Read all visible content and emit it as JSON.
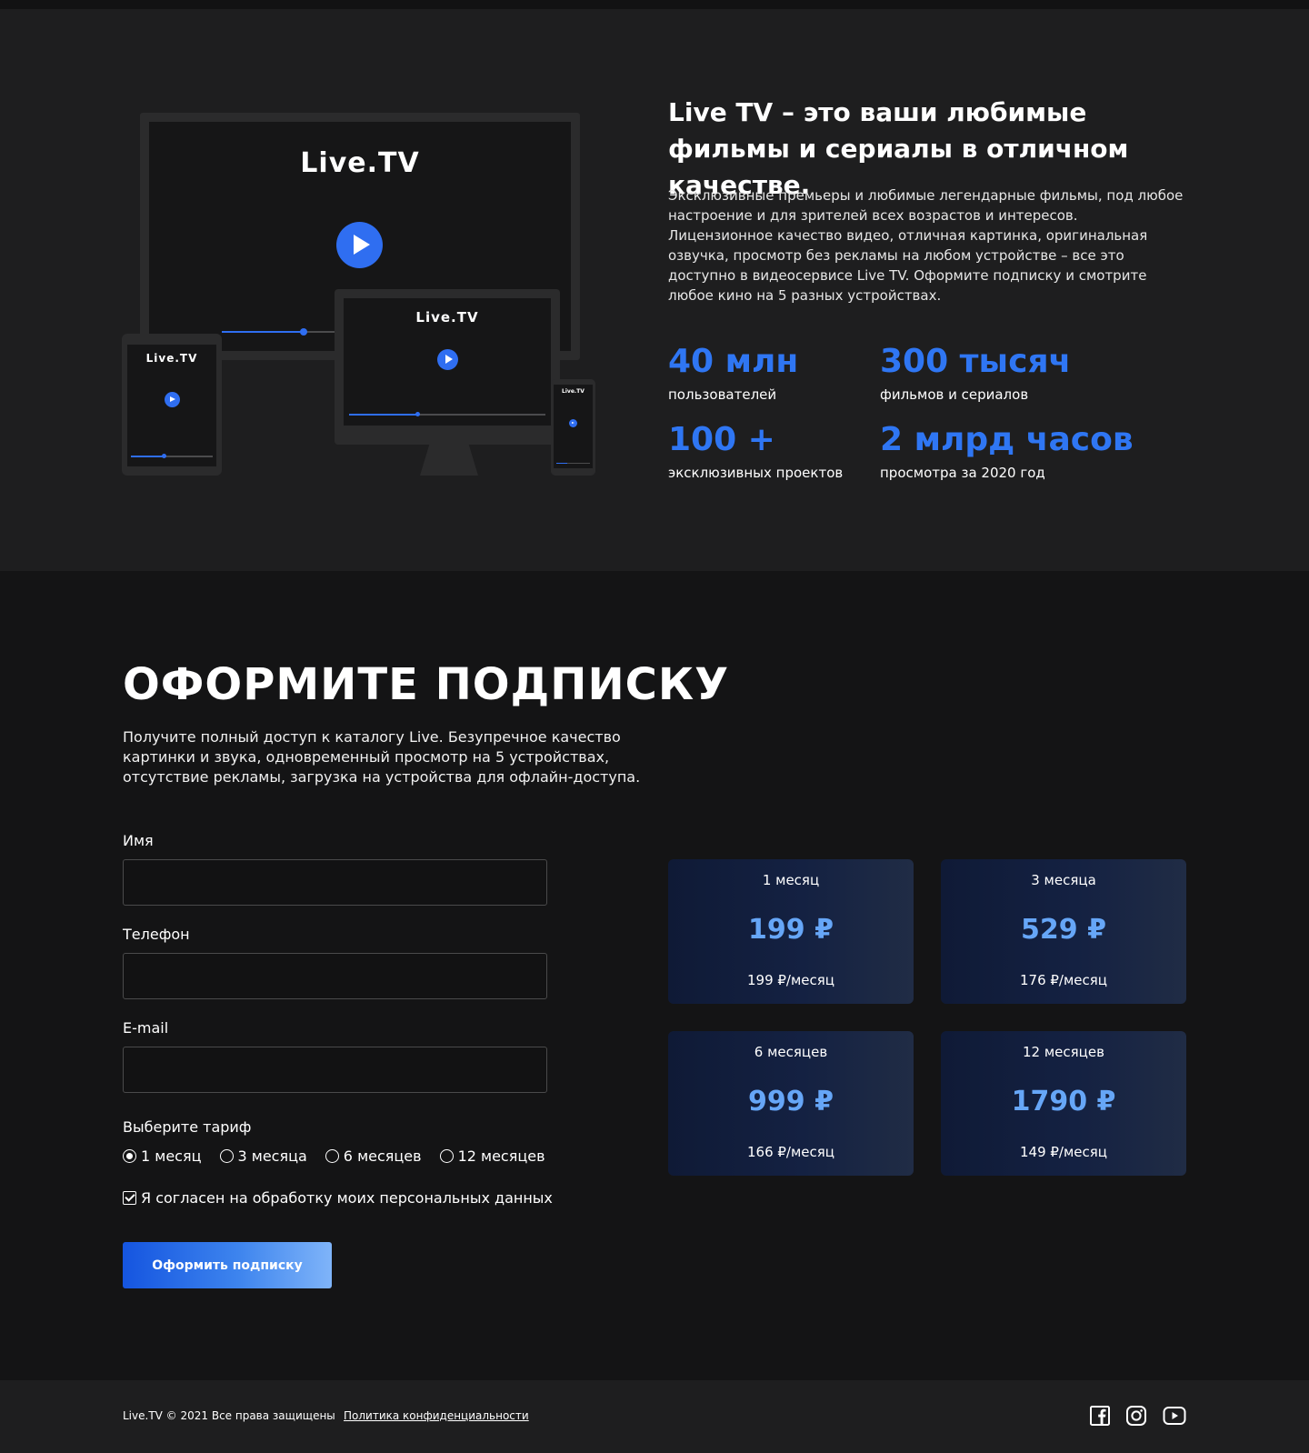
{
  "hero": {
    "title": "Live TV – это ваши любимые фильмы и сериалы в отличном качестве.",
    "description": "Эксклюзивные премьеры и любимые легендарные фильмы, под любое настроение и для зрителей всех возрастов и интересов. Лицензионное качество видео, отличная картинка, оригинальная озвучка, просмотр без рекламы на любом устройстве – все это доступно в видеосервисе Live TV.  Оформите подписку и смотрите любое кино на 5 разных устройствах.",
    "device_brand": "Live.TV",
    "stats": [
      {
        "value": "40 млн",
        "label": "пользователей"
      },
      {
        "value": "300 тысяч",
        "label": "фильмов и сериалов"
      },
      {
        "value": "100 +",
        "label": "эксклюзивных проектов"
      },
      {
        "value": "2 млрд часов",
        "label": "просмотра за 2020 год"
      }
    ]
  },
  "subscribe": {
    "title": "ОФОРМИТЕ ПОДПИСКУ",
    "description": "Получите полный доступ к каталогу Live. Безупречное качество картинки и звука, одновременный просмотр на 5 устройствах, отсутствие рекламы, загрузка на устройства для офлайн-доступа.",
    "fields": {
      "name_label": "Имя",
      "name_value": "",
      "phone_label": "Телефон",
      "phone_value": "",
      "email_label": "E-mail",
      "email_value": ""
    },
    "tariff_label": "Выберите тариф",
    "tariffs": [
      "1 месяц",
      "3 месяца",
      "6 месяцев",
      "12 месяцев"
    ],
    "selected_tariff": "1 месяц",
    "agree_label": "Я согласен на обработку моих персональных данных",
    "agree_checked": true,
    "submit_label": "Оформить подписку",
    "plans": [
      {
        "period": "1 месяц",
        "price": "199 ₽",
        "per_month": "199 ₽/месяц"
      },
      {
        "period": "3 месяца",
        "price": "529 ₽",
        "per_month": "176 ₽/месяц"
      },
      {
        "period": "6 месяцев",
        "price": "999 ₽",
        "per_month": "166 ₽/месяц"
      },
      {
        "period": "12 месяцев",
        "price": "1790 ₽",
        "per_month": "149 ₽/месяц"
      }
    ]
  },
  "footer": {
    "copyright": "Live.TV © 2021 Все права защищены",
    "policy_link": "Политика конфиденциальности",
    "social_icons": [
      "facebook-icon",
      "instagram-icon",
      "youtube-icon"
    ]
  },
  "colors": {
    "accent": "#2f76f3",
    "price": "#66a6f7",
    "background": "#141415",
    "hero_background": "#1e1e1f"
  }
}
